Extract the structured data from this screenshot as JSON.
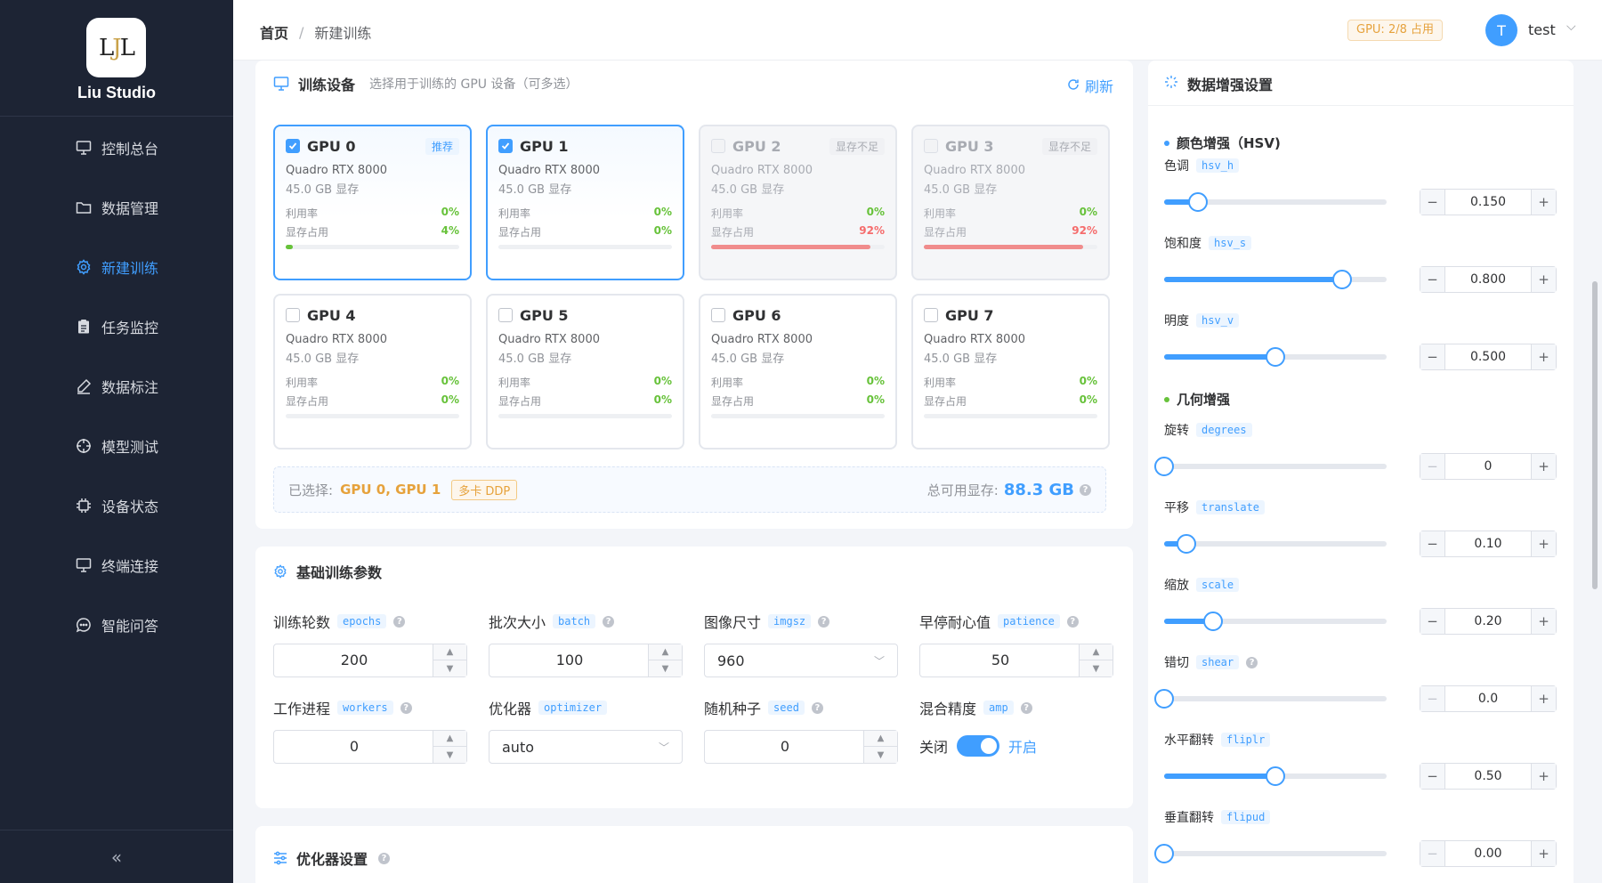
{
  "sidebar": {
    "brand": "Liu Studio",
    "logo_left": "L",
    "logo_mid": "J",
    "logo_right": "L",
    "items": [
      {
        "label": "控制总台",
        "icon": "monitor-icon"
      },
      {
        "label": "数据管理",
        "icon": "folder-icon"
      },
      {
        "label": "新建训练",
        "icon": "gear-icon",
        "active": true
      },
      {
        "label": "任务监控",
        "icon": "clipboard-icon"
      },
      {
        "label": "数据标注",
        "icon": "pen-icon"
      },
      {
        "label": "模型测试",
        "icon": "target-icon"
      },
      {
        "label": "设备状态",
        "icon": "chip-icon"
      },
      {
        "label": "终端连接",
        "icon": "terminal-icon"
      },
      {
        "label": "智能问答",
        "icon": "chat-icon"
      }
    ],
    "collapse": "«"
  },
  "header": {
    "breadcrumb_home": "首页",
    "breadcrumb_sep": "/",
    "breadcrumb_current": "新建训练",
    "gpu_badge": "GPU: 2/8 占用",
    "avatar_letter": "T",
    "username": "test"
  },
  "devices": {
    "title": "训练设备",
    "subtitle": "选择用于训练的 GPU 设备（可多选）",
    "refresh": "刷新",
    "util_label": "利用率",
    "mem_label": "显存占用",
    "gpus": [
      {
        "name": "GPU 0",
        "model": "Quadro RTX 8000",
        "mem": "45.0 GB 显存",
        "util": "0%",
        "mem_used": "4%",
        "tag": "推荐"
      },
      {
        "name": "GPU 1",
        "model": "Quadro RTX 8000",
        "mem": "45.0 GB 显存",
        "util": "0%",
        "mem_used": "0%",
        "tag": ""
      },
      {
        "name": "GPU 2",
        "model": "Quadro RTX 8000",
        "mem": "45.0 GB 显存",
        "util": "0%",
        "mem_used": "92%",
        "tag": "显存不足"
      },
      {
        "name": "GPU 3",
        "model": "Quadro RTX 8000",
        "mem": "45.0 GB 显存",
        "util": "0%",
        "mem_used": "92%",
        "tag": "显存不足"
      },
      {
        "name": "GPU 4",
        "model": "Quadro RTX 8000",
        "mem": "45.0 GB 显存",
        "util": "0%",
        "mem_used": "0%",
        "tag": ""
      },
      {
        "name": "GPU 5",
        "model": "Quadro RTX 8000",
        "mem": "45.0 GB 显存",
        "util": "0%",
        "mem_used": "0%",
        "tag": ""
      },
      {
        "name": "GPU 6",
        "model": "Quadro RTX 8000",
        "mem": "45.0 GB 显存",
        "util": "0%",
        "mem_used": "0%",
        "tag": ""
      },
      {
        "name": "GPU 7",
        "model": "Quadro RTX 8000",
        "mem": "45.0 GB 显存",
        "util": "0%",
        "mem_used": "0%",
        "tag": ""
      }
    ],
    "selected_label": "已选择:",
    "selected_value": "GPU 0, GPU 1",
    "mode_tag": "多卡 DDP",
    "total_label": "总可用显存:",
    "total_value": "88.3 GB"
  },
  "basic": {
    "title": "基础训练参数",
    "epochs": {
      "label": "训练轮数",
      "code": "epochs",
      "value": "200"
    },
    "batch": {
      "label": "批次大小",
      "code": "batch",
      "value": "100"
    },
    "imgsz": {
      "label": "图像尺寸",
      "code": "imgsz",
      "value": "960"
    },
    "patience": {
      "label": "早停耐心值",
      "code": "patience",
      "value": "50"
    },
    "workers": {
      "label": "工作进程",
      "code": "workers",
      "value": "0"
    },
    "optimizer": {
      "label": "优化器",
      "code": "optimizer",
      "value": "auto"
    },
    "seed": {
      "label": "随机种子",
      "code": "seed",
      "value": "0"
    },
    "amp": {
      "label": "混合精度",
      "code": "amp",
      "off": "关闭",
      "on": "开启"
    }
  },
  "optim": {
    "title": "优化器设置"
  },
  "augment": {
    "title": "数据增强设置",
    "hsv_section": "颜色增强（HSV)",
    "geo_section": "几何增强",
    "items": [
      {
        "label": "色调",
        "code": "hsv_h",
        "value": "0.150",
        "ratio": 0.15
      },
      {
        "label": "饱和度",
        "code": "hsv_s",
        "value": "0.800",
        "ratio": 0.8
      },
      {
        "label": "明度",
        "code": "hsv_v",
        "value": "0.500",
        "ratio": 0.5
      },
      {
        "label": "旋转",
        "code": "degrees",
        "value": "0",
        "ratio": 0.0
      },
      {
        "label": "平移",
        "code": "translate",
        "value": "0.10",
        "ratio": 0.1
      },
      {
        "label": "缩放",
        "code": "scale",
        "value": "0.20",
        "ratio": 0.22
      },
      {
        "label": "错切",
        "code": "shear",
        "value": "0.0",
        "ratio": 0.0
      },
      {
        "label": "水平翻转",
        "code": "fliplr",
        "value": "0.50",
        "ratio": 0.5
      },
      {
        "label": "垂直翻转",
        "code": "flipud",
        "value": "0.00",
        "ratio": 0.0
      }
    ]
  }
}
